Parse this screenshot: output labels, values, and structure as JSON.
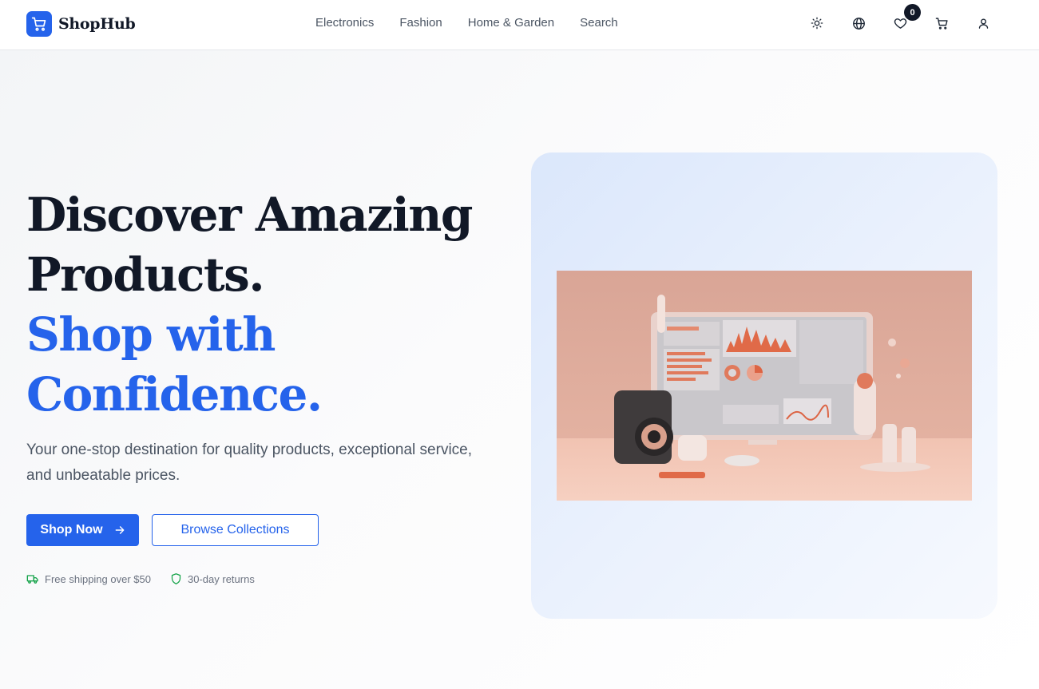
{
  "header": {
    "brand": "ShopHub",
    "nav": [
      "Electronics",
      "Fashion",
      "Home & Garden",
      "Search"
    ],
    "icons": [
      "sun-icon",
      "globe-icon",
      "heart-icon",
      "cart-icon",
      "user-icon"
    ],
    "wishlist_count": "0"
  },
  "hero": {
    "headline_line1": "Discover Amazing",
    "headline_line2": "Products.",
    "headline_line3": "Shop with",
    "headline_line4": "Confidence.",
    "subtitle": "Your one-stop destination for quality products, exceptional service, and unbeatable prices.",
    "primary_button": "Shop Now",
    "secondary_button": "Browse Collections",
    "features": [
      "Free shipping over $50",
      "30-day returns"
    ]
  },
  "colors": {
    "accent": "#2563eb",
    "heading": "#111827",
    "muted": "#4b5563",
    "feature_icon": "#16a34a"
  }
}
